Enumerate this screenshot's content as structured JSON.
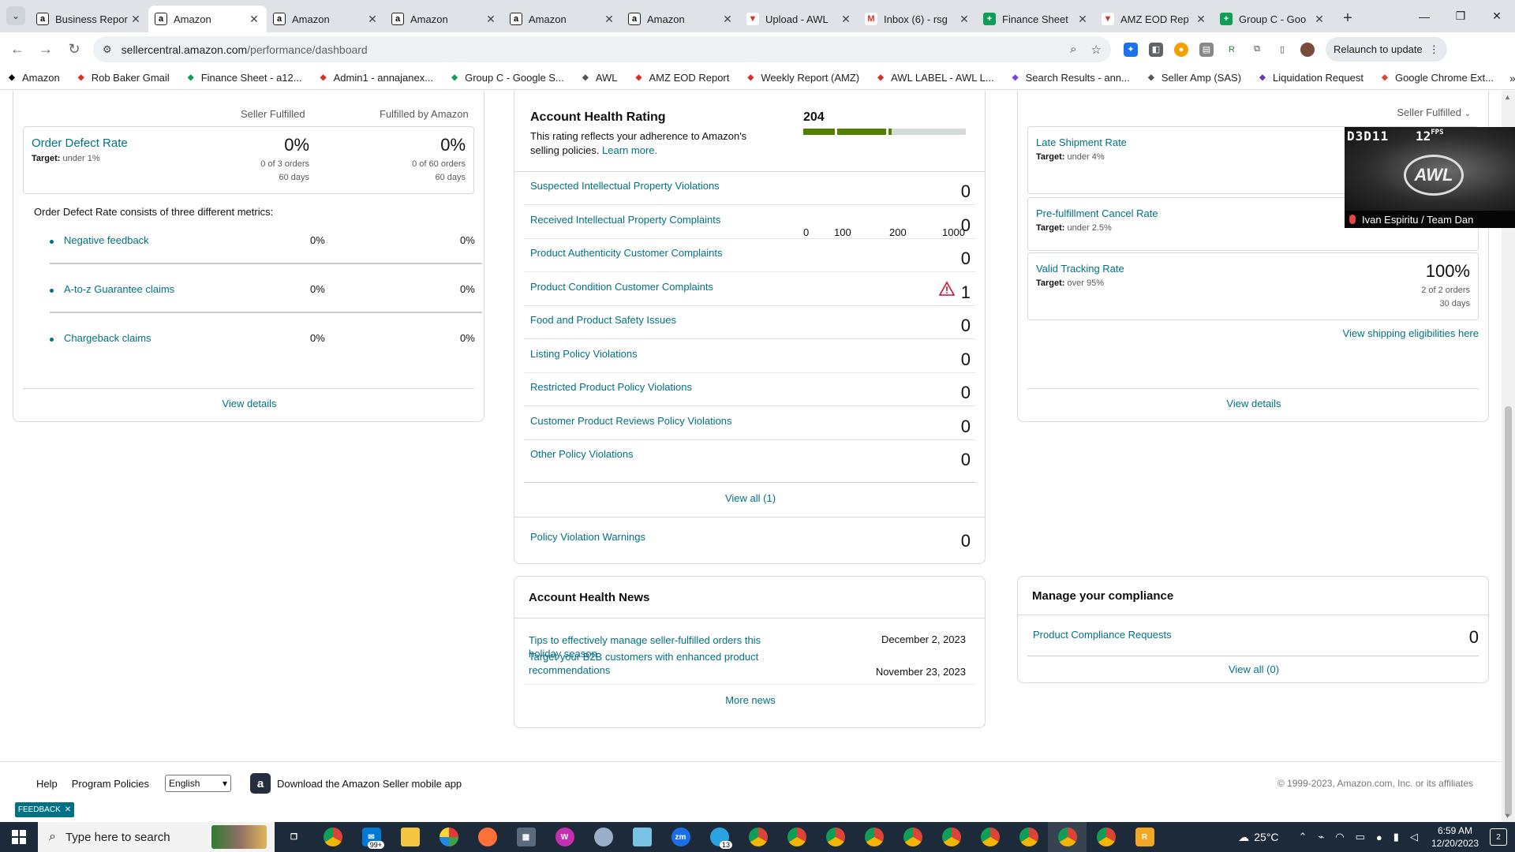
{
  "browser": {
    "tabs": [
      {
        "title": "Business Repor",
        "favicon": "amazon-icon",
        "active": false
      },
      {
        "title": "Amazon",
        "favicon": "amazon-icon",
        "active": true
      },
      {
        "title": "Amazon",
        "favicon": "amazon-icon",
        "active": false
      },
      {
        "title": "Amazon",
        "favicon": "amazon-icon",
        "active": false
      },
      {
        "title": "Amazon",
        "favicon": "amazon-icon",
        "active": false
      },
      {
        "title": "Amazon",
        "favicon": "amazon-icon",
        "active": false
      },
      {
        "title": "Upload - AWL",
        "favicon": "awl-icon",
        "active": false
      },
      {
        "title": "Inbox (6) - rsg",
        "favicon": "gmail-icon",
        "active": false
      },
      {
        "title": "Finance Sheet",
        "favicon": "sheets-icon",
        "active": false
      },
      {
        "title": "AMZ EOD Rep",
        "favicon": "awl-icon",
        "active": false
      },
      {
        "title": "Group C - Goo",
        "favicon": "sheets-icon",
        "active": false
      }
    ],
    "url_host": "sellercentral.amazon.com",
    "url_path": "/performance/dashboard",
    "relaunch_label": "Relaunch to update",
    "bookmarks": [
      {
        "label": "Amazon",
        "icon": "amazon-icon"
      },
      {
        "label": "Rob Baker Gmail",
        "icon": "gmail-icon"
      },
      {
        "label": "Finance Sheet - a12...",
        "icon": "sheets-icon"
      },
      {
        "label": "Admin1 - annajanex...",
        "icon": "gmail-icon"
      },
      {
        "label": "Group C - Google S...",
        "icon": "sheets-icon"
      },
      {
        "label": "AWL",
        "icon": "globe-icon"
      },
      {
        "label": "AMZ EOD Report",
        "icon": "awl-icon"
      },
      {
        "label": "Weekly Report (AMZ)",
        "icon": "awl-icon"
      },
      {
        "label": "AWL LABEL - AWL L...",
        "icon": "awl-icon"
      },
      {
        "label": "Search Results - ann...",
        "icon": "puzzle-icon"
      },
      {
        "label": "Seller Amp (SAS)",
        "icon": "globe-icon"
      },
      {
        "label": "Liquidation Request",
        "icon": "forms-icon"
      },
      {
        "label": "Google Chrome Ext...",
        "icon": "chrome-icon"
      }
    ]
  },
  "customer_service": {
    "col_seller": "Seller Fulfilled",
    "col_fba": "Fulfilled by Amazon",
    "odr": {
      "title": "Order Defect Rate",
      "target_label": "Target:",
      "target_value": "under 1%",
      "seller_pct": "0%",
      "seller_orders": "0 of 3 orders",
      "seller_days": "60 days",
      "fba_pct": "0%",
      "fba_orders": "0 of 60 orders",
      "fba_days": "60 days"
    },
    "description": "Order Defect Rate consists of three different metrics:",
    "metrics": [
      {
        "label": "Negative feedback",
        "seller": "0%",
        "fba": "0%"
      },
      {
        "label": "A-to-z Guarantee claims",
        "seller": "0%",
        "fba": "0%"
      },
      {
        "label": "Chargeback claims",
        "seller": "0%",
        "fba": "0%"
      }
    ],
    "view_details": "View details"
  },
  "account_health": {
    "title": "Account Health Rating",
    "description_1": "This rating reflects your adherence to Amazon's selling policies. ",
    "learn_more": "Learn more.",
    "score": "204",
    "bar_ticks": [
      "0",
      "100",
      "200",
      "1000"
    ],
    "score_fraction": 0.55,
    "bar_colors": {
      "green": "#538000",
      "grey": "#d5d9d9"
    },
    "violations": [
      {
        "label": "Suspected Intellectual Property Violations",
        "count": "0",
        "warning": false
      },
      {
        "label": "Received Intellectual Property Complaints",
        "count": "0",
        "warning": false
      },
      {
        "label": "Product Authenticity Customer Complaints",
        "count": "0",
        "warning": false
      },
      {
        "label": "Product Condition Customer Complaints",
        "count": "1",
        "warning": true
      },
      {
        "label": "Food and Product Safety Issues",
        "count": "0",
        "warning": false
      },
      {
        "label": "Listing Policy Violations",
        "count": "0",
        "warning": false
      },
      {
        "label": "Restricted Product Policy Violations",
        "count": "0",
        "warning": false
      },
      {
        "label": "Customer Product Reviews Policy Violations",
        "count": "0",
        "warning": false
      },
      {
        "label": "Other Policy Violations",
        "count": "0",
        "warning": false
      }
    ],
    "view_all": "View all (1)",
    "policy_warnings_label": "Policy Violation Warnings",
    "policy_warnings_count": "0"
  },
  "news": {
    "title": "Account Health News",
    "items": [
      {
        "title": "Tips to effectively manage seller-fulfilled orders this holiday season",
        "date": "December 2, 2023"
      },
      {
        "title": "Target your B2B customers with enhanced product recommendations",
        "date": "November 23, 2023"
      }
    ],
    "more": "More news"
  },
  "shipping": {
    "dropdown": "Seller Fulfilled",
    "late_shipment": {
      "title": "Late Shipment Rate",
      "target_label": "Target:",
      "target_value": "under 4%"
    },
    "cancel": {
      "title": "Pre-fulfillment Cancel Rate",
      "target_label": "Target:",
      "target_value": "under 2.5%"
    },
    "tracking": {
      "title": "Valid Tracking Rate",
      "target_label": "Target:",
      "target_value": "over 95%",
      "pct": "100%",
      "orders": "2 of 2 orders",
      "days": "30 days"
    },
    "eligibilities": "View shipping eligibilities here",
    "view_details": "View details"
  },
  "compliance": {
    "title": "Manage your compliance",
    "requests_label": "Product Compliance Requests",
    "requests_count": "0",
    "view_all": "View all (0)"
  },
  "footer": {
    "help": "Help",
    "policies": "Program Policies",
    "language": "English",
    "app_text": "Download the Amazon Seller mobile app",
    "copyright": "© 1999-2023, Amazon.com, Inc. or its affiliates",
    "feedback": "FEEDBACK"
  },
  "overlay": {
    "hud_left": "D3D11",
    "fps": "12",
    "fps_unit": "FPS",
    "logo": "AWL",
    "caption": "Ivan Espiritu / Team Dan"
  },
  "taskbar": {
    "search_placeholder": "Type here to search",
    "mail_badge": "99+",
    "chat_badge": "13",
    "temperature": "25°C",
    "time": "6:59 AM",
    "date": "12/20/2023",
    "notifications": "2"
  }
}
